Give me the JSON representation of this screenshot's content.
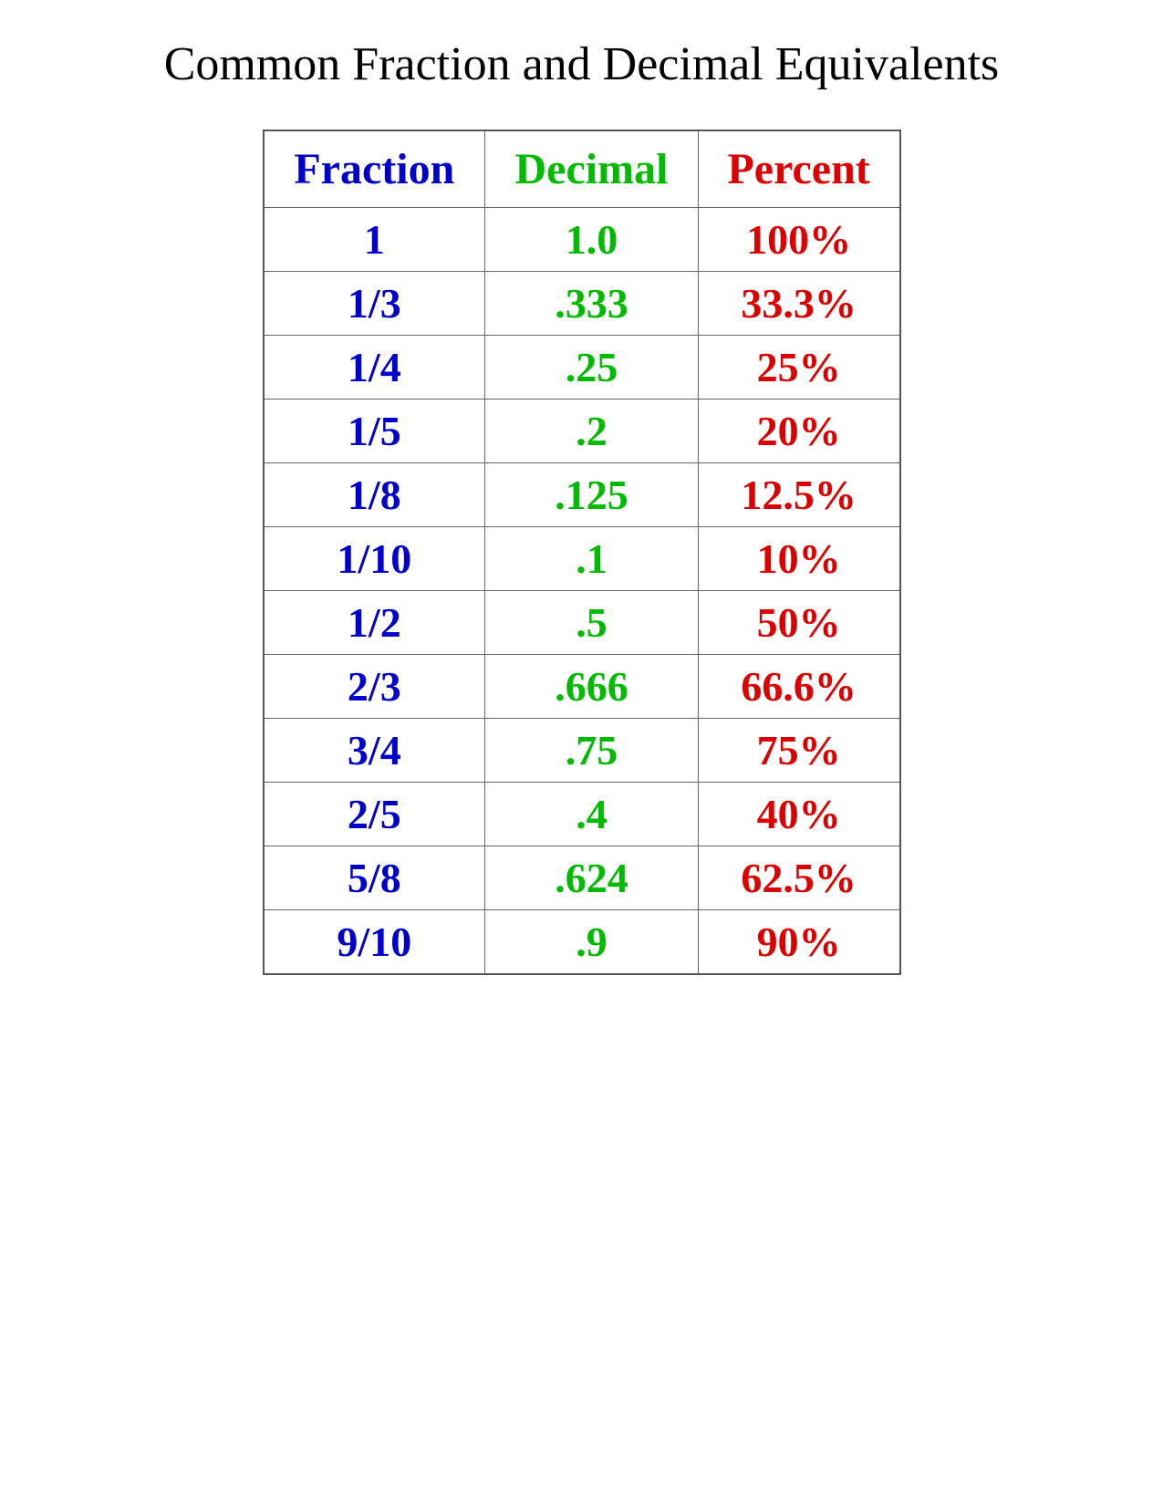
{
  "title": "Common Fraction and Decimal Equivalents",
  "table": {
    "headers": [
      "Fraction",
      "Decimal",
      "Percent"
    ],
    "rows": [
      {
        "fraction": "1",
        "decimal": "1.0",
        "percent": "100%"
      },
      {
        "fraction": "1/3",
        "decimal": ".333",
        "percent": "33.3%"
      },
      {
        "fraction": "1/4",
        "decimal": ".25",
        "percent": "25%"
      },
      {
        "fraction": "1/5",
        "decimal": ".2",
        "percent": "20%"
      },
      {
        "fraction": "1/8",
        "decimal": ".125",
        "percent": "12.5%"
      },
      {
        "fraction": "1/10",
        "decimal": ".1",
        "percent": "10%"
      },
      {
        "fraction": "1/2",
        "decimal": ".5",
        "percent": "50%"
      },
      {
        "fraction": "2/3",
        "decimal": ".666",
        "percent": "66.6%"
      },
      {
        "fraction": "3/4",
        "decimal": ".75",
        "percent": "75%"
      },
      {
        "fraction": "2/5",
        "decimal": ".4",
        "percent": "40%"
      },
      {
        "fraction": "5/8",
        "decimal": ".624",
        "percent": "62.5%"
      },
      {
        "fraction": "9/10",
        "decimal": ".9",
        "percent": "90%"
      }
    ]
  },
  "colors": {
    "fraction": "#0000cc",
    "decimal": "#00bb00",
    "percent": "#dd0000",
    "title": "#000000"
  }
}
